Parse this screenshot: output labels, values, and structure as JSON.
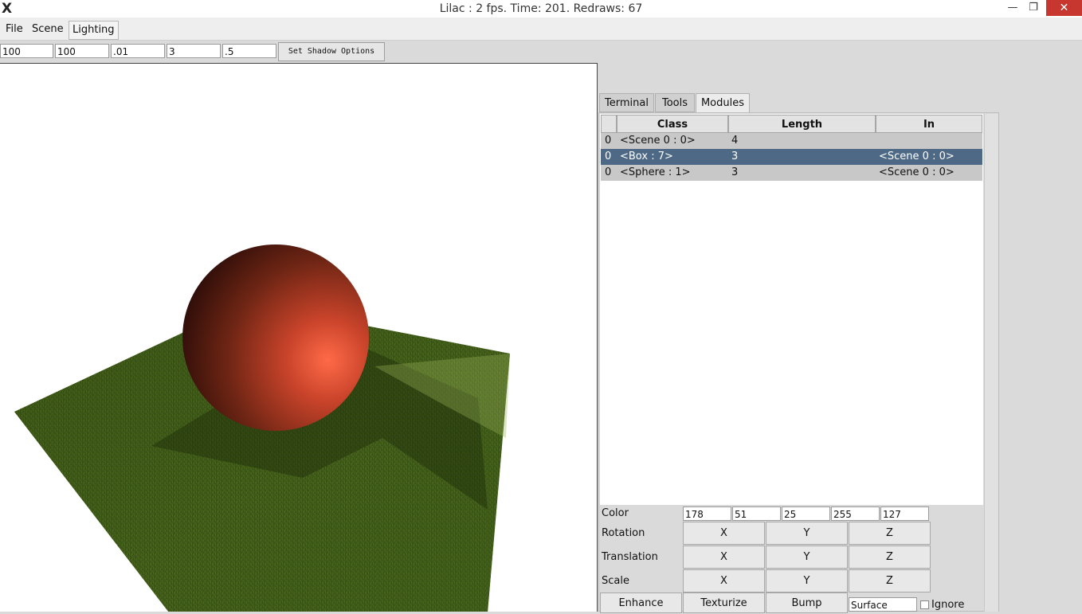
{
  "window": {
    "title": "Lilac : 2 fps. Time: 201. Redraws: 67",
    "app_icon_glyph": "X",
    "minimize_glyph": "—",
    "restore_glyph": "❐",
    "close_glyph": "✕"
  },
  "menubar": {
    "items": [
      {
        "label": "File"
      },
      {
        "label": "Scene"
      },
      {
        "label": "Lighting"
      }
    ]
  },
  "shadow_options": {
    "fields": [
      "100",
      "100",
      ".01",
      "3",
      ".5"
    ],
    "button_label": "Set Shadow Options"
  },
  "tabs": [
    {
      "label": "Terminal"
    },
    {
      "label": "Tools"
    },
    {
      "label": "Modules",
      "active": true
    }
  ],
  "table": {
    "columns": [
      "",
      "Class",
      "Length",
      "In"
    ],
    "rows": [
      {
        "index": "0",
        "class": "<Scene 0 : 0>",
        "length": "4",
        "in": "",
        "selected": false
      },
      {
        "index": "0",
        "class": "<Box : 7>",
        "length": "3",
        "in": "<Scene 0 : 0>",
        "selected": true
      },
      {
        "index": "0",
        "class": "<Sphere : 1>",
        "length": "3",
        "in": "<Scene 0 : 0>",
        "selected": false
      }
    ]
  },
  "properties": {
    "color_label": "Color",
    "color_values": [
      "178",
      "51",
      "25",
      "255",
      "127"
    ],
    "rotation_label": "Rotation",
    "translation_label": "Translation",
    "scale_label": "Scale",
    "axes": [
      "X",
      "Y",
      "Z"
    ]
  },
  "bottom_bar": {
    "enhance": "Enhance",
    "texturize": "Texturize",
    "bump": "Bump",
    "surface_value": "Surface",
    "ignore_label": "Ignore"
  },
  "colors": {
    "selected_row": "#4d6986",
    "row_bg": "#c8c8c8",
    "sphere": "#b23319",
    "grass": "#4e6b1f",
    "close_button": "#c7372f"
  }
}
